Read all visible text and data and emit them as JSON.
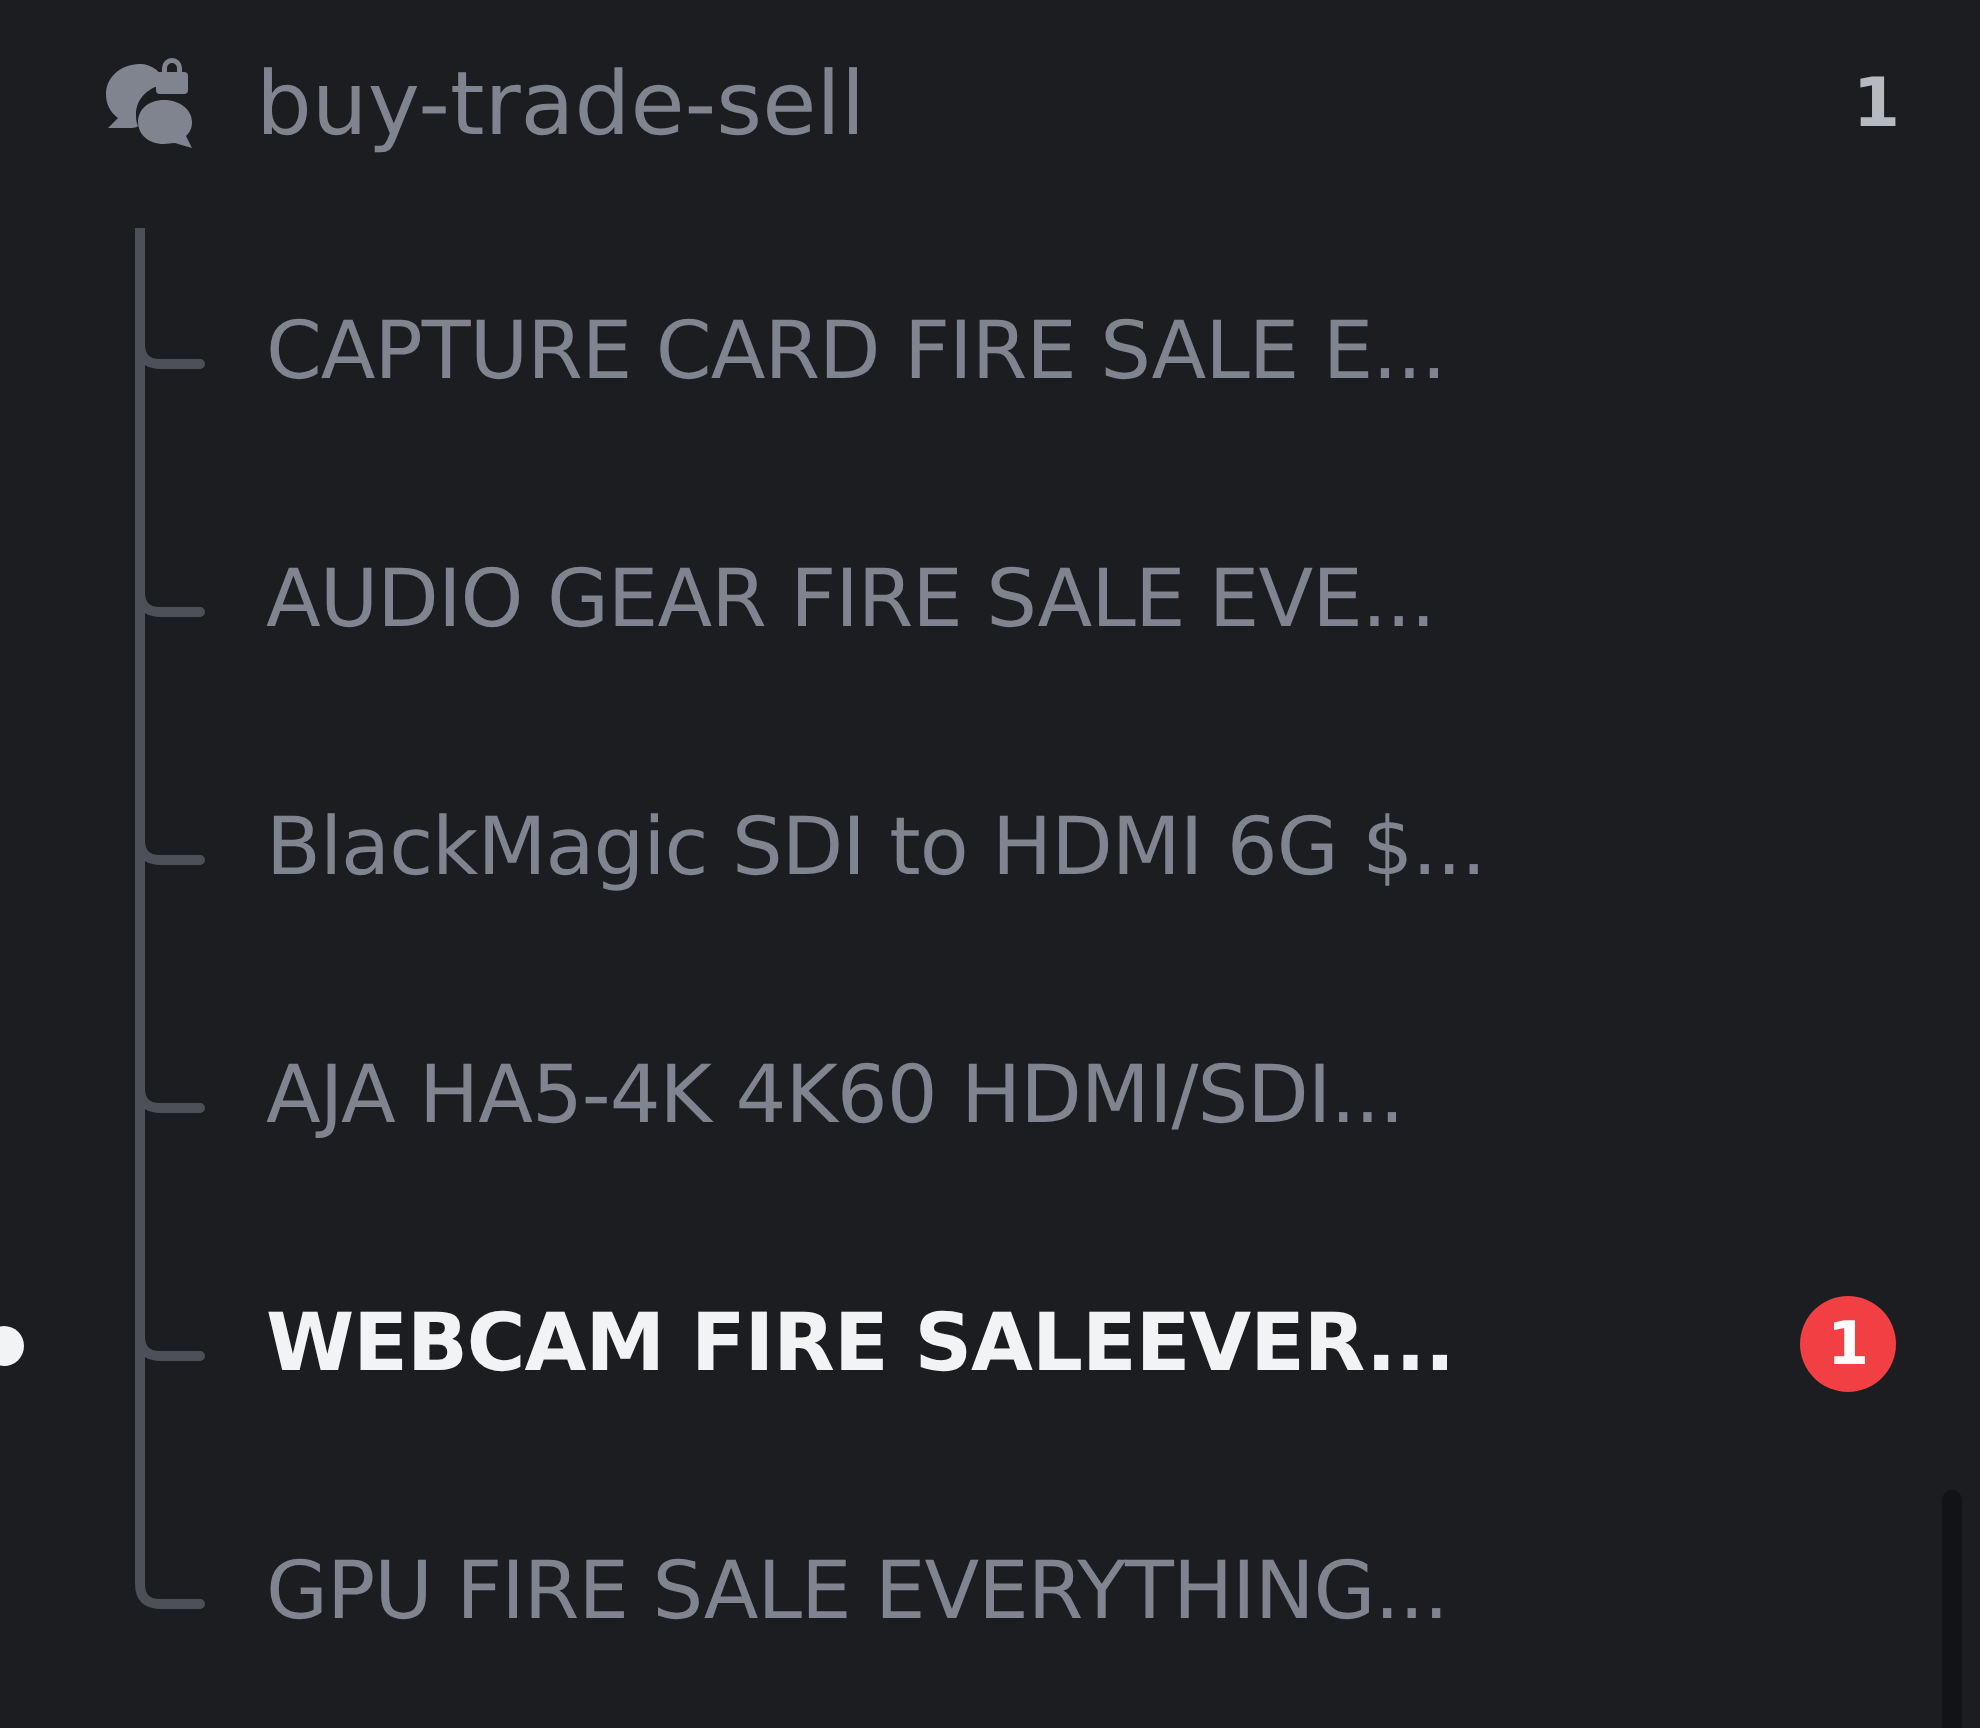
{
  "channel": {
    "name": "buy-trade-sell",
    "count": "1"
  },
  "threads": [
    {
      "title": "CAPTURE CARD FIRE SALE E...",
      "unread": false
    },
    {
      "title": "AUDIO GEAR FIRE SALE EVE...",
      "unread": false
    },
    {
      "title": "BlackMagic SDI to HDMI 6G $...",
      "unread": false
    },
    {
      "title": "AJA HA5-4K 4K60 HDMI/SDI...",
      "unread": false
    },
    {
      "title": "WEBCAM FIRE SALEEVER...",
      "unread": true,
      "badge": "1"
    },
    {
      "title": "GPU FIRE SALE EVERYTHING...",
      "unread": false
    }
  ]
}
